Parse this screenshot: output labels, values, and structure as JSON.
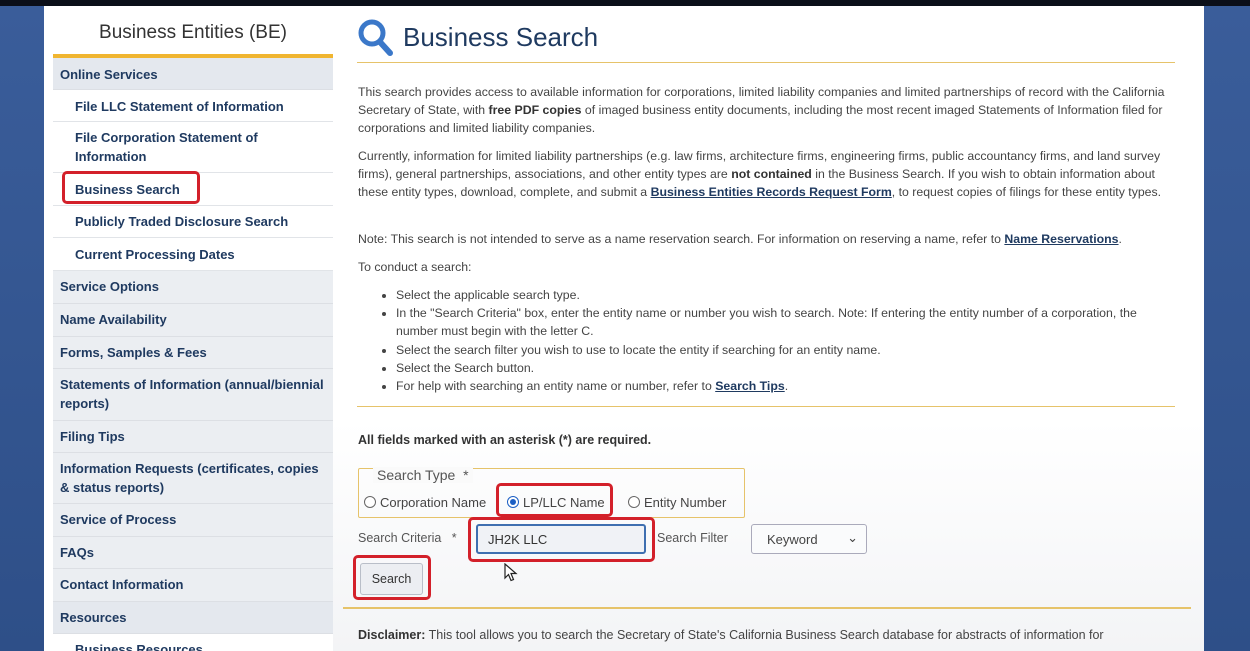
{
  "sidebar": {
    "title": "Business Entities (BE)",
    "items": [
      {
        "label": "Online Services"
      },
      {
        "label": "File LLC Statement of Information"
      },
      {
        "label": "File Corporation Statement of Information"
      },
      {
        "label": "Business Search"
      },
      {
        "label": "Publicly Traded Disclosure Search"
      },
      {
        "label": "Current Processing Dates"
      },
      {
        "label": "Service Options"
      },
      {
        "label": "Name Availability"
      },
      {
        "label": "Forms, Samples & Fees"
      },
      {
        "label": "Statements of Information (annual/biennial reports)"
      },
      {
        "label": "Filing Tips"
      },
      {
        "label": "Information Requests (certificates, copies & status reports)"
      },
      {
        "label": "Service of Process"
      },
      {
        "label": "FAQs"
      },
      {
        "label": "Contact Information"
      },
      {
        "label": "Resources"
      },
      {
        "label": "Business Resources"
      }
    ]
  },
  "main": {
    "title": "Business Search",
    "p1": {
      "a": "This search provides access to available information for corporations, limited liability companies and limited partnerships of record with the California Secretary of State, with ",
      "b": "free PDF copies",
      "c": " of imaged business entity documents, including the most recent imaged Statements of Information filed for corporations and limited liability companies."
    },
    "p2": {
      "a": "Currently, information for limited liability partnerships (e.g. law firms, architecture firms, engineering firms, public accountancy firms, and land survey firms), general partnerships, associations, and other entity types are ",
      "b": "not contained",
      "c": " in the Business Search. If you wish to obtain information about these entity types, download, complete, and submit a ",
      "link": "Business Entities Records Request Form",
      "d": ", to request copies of filings for these entity types."
    },
    "p3": {
      "a": "Note: This search is not intended to serve as a name reservation search. For information on reserving a name, refer to ",
      "link": "Name Reservations",
      "b": "."
    },
    "p4": "To conduct a search:",
    "steps": [
      "Select the applicable search type.",
      "In the \"Search Criteria\" box, enter the entity name or number you wish to search. Note: If entering the entity number of a corporation, the number must begin with the letter C.",
      "Select the search filter you wish to use to locate the entity if searching for an entity name.",
      "Select the Search button."
    ],
    "step5": {
      "a": "For help with searching an entity name or number, refer to ",
      "link": "Search Tips",
      "b": "."
    },
    "required_note": "All fields marked with an asterisk (*) are required.",
    "search_type_legend": "Search Type",
    "asterisk": "*",
    "radio_options": [
      "Corporation Name",
      "LP/LLC Name",
      "Entity Number"
    ],
    "selected_radio": "LP/LLC Name",
    "search_criteria_label": "Search Criteria",
    "search_criteria_value": "JH2K LLC",
    "search_filter_label": "Search Filter",
    "search_filter_value": "Keyword",
    "search_button": "Search",
    "disclaimer_label": "Disclaimer:",
    "disclaimer_text": " This tool allows you to search the Secretary of State's California Business Search database for abstracts of information for"
  },
  "colors": {
    "highlight": "#d3202a",
    "accent": "#f0b530",
    "link": "#1f3a60"
  },
  "icons": {
    "title_icon": "magnifier-icon"
  }
}
